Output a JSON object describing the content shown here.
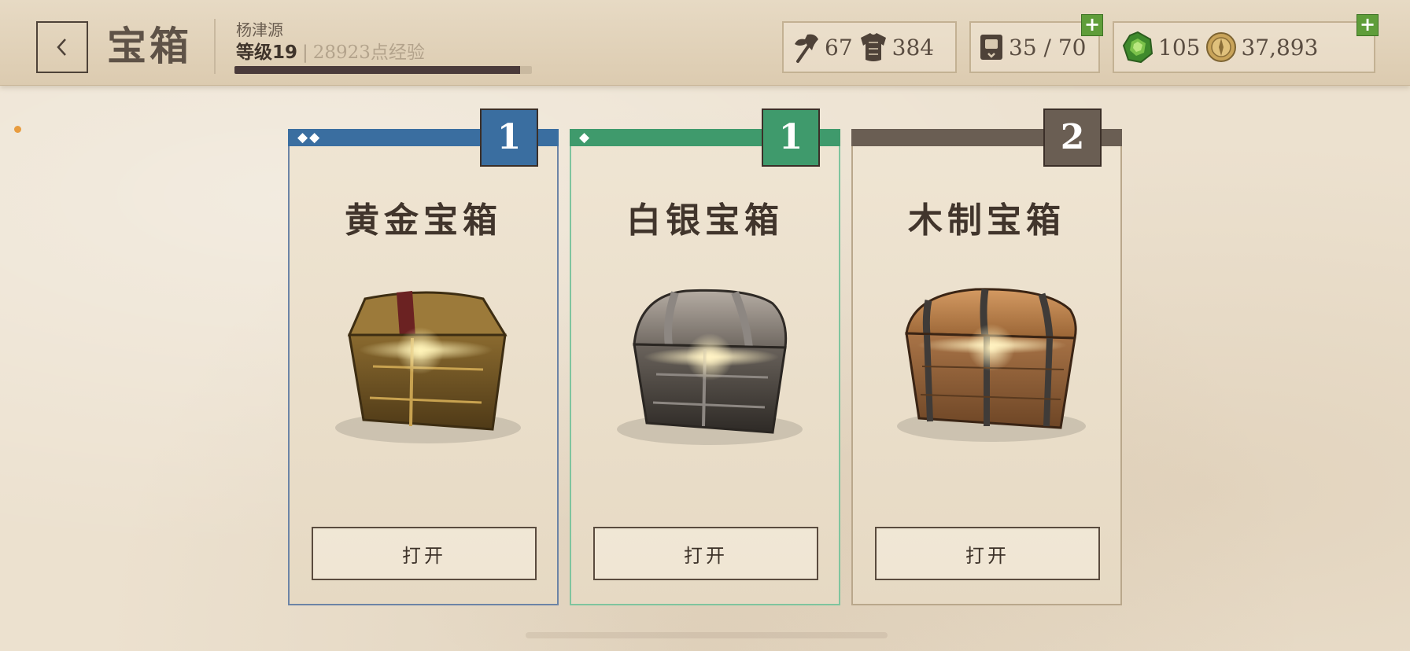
{
  "header": {
    "title": "宝箱",
    "player_name": "杨津源",
    "level_label": "等级19",
    "xp_text": "28923点经验",
    "xp_progress": 0.96
  },
  "stats": {
    "attack": "67",
    "defense": "384",
    "inventory": "35 / 70",
    "gems": "105",
    "gold": "37,893"
  },
  "chests": [
    {
      "name": "黄金宝箱",
      "count": "1",
      "rarity": "◆◆",
      "color": "#3a6ea0",
      "button": "打开"
    },
    {
      "name": "白银宝箱",
      "count": "1",
      "rarity": "◆",
      "color": "#3f9a6c",
      "button": "打开"
    },
    {
      "name": "木制宝箱",
      "count": "2",
      "rarity": "",
      "color": "#6a5e53",
      "button": "打开"
    }
  ],
  "icons": [
    "back-icon",
    "axe-icon",
    "armor-icon",
    "inventory-icon",
    "gem-icon",
    "gold-coin-icon",
    "plus-icon"
  ],
  "colors": {
    "accent_plus": "#5f9d3a",
    "xp_bar": "#4a3a3a"
  }
}
